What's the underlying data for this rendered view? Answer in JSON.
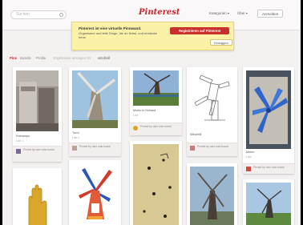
{
  "header": {
    "search_placeholder": "Suchen",
    "logo": "Pinterest",
    "nav": [
      "Kategorien",
      "Über",
      "Anmelden"
    ]
  },
  "banner": {
    "title": "Pinterest ist eine virtuelle Pinnwand.",
    "text": "Organisiere und teile Dinge, die du liebst, und entdecke neue.",
    "cta_label": "Registrieren auf Pinterest",
    "secondary_label": "Einloggen"
  },
  "filters": {
    "items": [
      "Pins",
      "Boards",
      "Profile"
    ],
    "note": "Ergebnisse anzeigen für",
    "query": "windmill"
  },
  "pins": [
    {
      "desc": "Kolmanpo",
      "stats": "Like 1",
      "foot": "Pinned by user onto board"
    },
    {
      "desc": "Turm",
      "stats": "Like 1",
      "foot": "Pinned by user onto board"
    },
    {
      "desc": "Molen in Holland",
      "stats": "Like",
      "foot": "Pinned by user onto board"
    },
    {
      "desc": "Windmill",
      "stats": "",
      "foot": "Pinned by user onto board"
    },
    {
      "desc": "Molen",
      "stats": "Like",
      "foot": "Pinned by user onto board"
    }
  ],
  "colors": {
    "brand": "#c8232c",
    "banner_bg": "#fbf2a8",
    "page_bg": "#f4f1f1"
  }
}
